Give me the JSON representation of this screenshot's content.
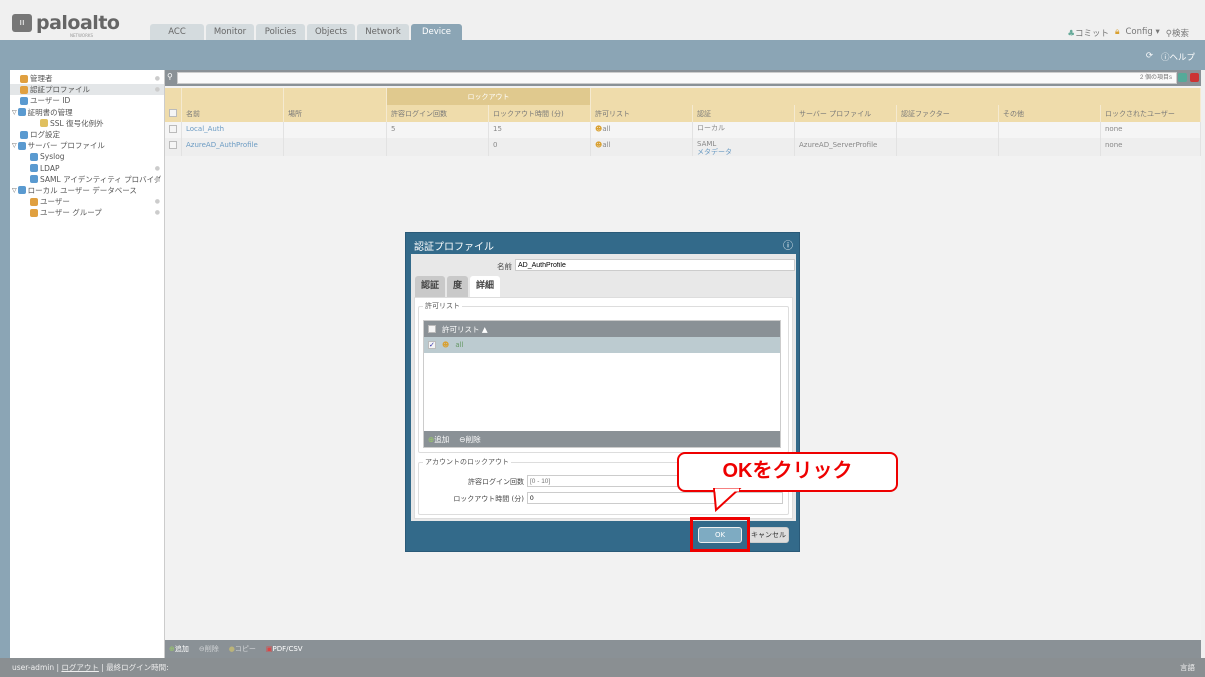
{
  "header": {
    "logo": "paloalto",
    "logo_sub": "NETWORKS",
    "tabs": [
      "ACC",
      "Monitor",
      "Policies",
      "Objects",
      "Network",
      "Device"
    ],
    "active_tab": "Device",
    "commit": "コミット",
    "config": "Config",
    "search": "検索",
    "help": "ヘルプ"
  },
  "sidebar": {
    "items": [
      {
        "label": "管理者",
        "indent": 0,
        "color": "#e0a040"
      },
      {
        "label": "認証プロファイル",
        "indent": 0,
        "color": "#e0a040",
        "selected": true
      },
      {
        "label": "ユーザー ID",
        "indent": 0,
        "color": "#5a9ad0"
      },
      {
        "label": "証明書の管理",
        "indent": 0,
        "color": "#5a9ad0",
        "expand": true
      },
      {
        "label": "SSL 復号化例外",
        "indent": 2,
        "color": "#e0c060"
      },
      {
        "label": "ログ設定",
        "indent": 0,
        "color": "#5a9ad0"
      },
      {
        "label": "サーバー プロファイル",
        "indent": 0,
        "color": "#5a9ad0",
        "expand": true
      },
      {
        "label": "Syslog",
        "indent": 1,
        "color": "#5a9ad0"
      },
      {
        "label": "LDAP",
        "indent": 1,
        "color": "#5a9ad0"
      },
      {
        "label": "SAML アイデンティティ プロバイダ",
        "indent": 1,
        "color": "#5a9ad0"
      },
      {
        "label": "ローカル ユーザー データベース",
        "indent": 0,
        "color": "#5a9ad0",
        "expand": true
      },
      {
        "label": "ユーザー",
        "indent": 1,
        "color": "#e0a040"
      },
      {
        "label": "ユーザー グループ",
        "indent": 1,
        "color": "#e0a040"
      }
    ]
  },
  "search": {
    "count": "2 個の項目s"
  },
  "table": {
    "group_header": "ロックアウト",
    "columns": [
      "名前",
      "場所",
      "許容ログイン回数",
      "ロックアウト時間 (分)",
      "許可リスト",
      "認証",
      "サーバー プロファイル",
      "認証ファクター",
      "その他",
      "ロックされたユーザー"
    ],
    "rows": [
      {
        "name": "Local_Auth",
        "location": "",
        "attempts": "5",
        "lockout": "15",
        "allow": "all",
        "auth": "ローカル",
        "auth2": "",
        "server": "",
        "factor": "",
        "other": "",
        "locked": "none"
      },
      {
        "name": "AzureAD_AuthProfile",
        "location": "",
        "attempts": "",
        "lockout": "0",
        "allow": "all",
        "auth": "SAML",
        "auth2": "メタデータ",
        "server": "AzureAD_ServerProfile",
        "factor": "",
        "other": "",
        "locked": "none"
      }
    ]
  },
  "toolbar": {
    "add": "追加",
    "delete": "削除",
    "copy": "コピー",
    "pdf": "PDF/CSV"
  },
  "footer": {
    "user": "user-admin",
    "logout": "ログアウト",
    "last_login": "最終ログイン時間:",
    "language": "言語"
  },
  "dialog": {
    "title": "認証プロファイル",
    "name_label": "名前",
    "name_value": "AD_AuthProfile",
    "tabs": [
      "認証",
      "度",
      "詳細"
    ],
    "active_tab": "詳細",
    "allow_legend": "許可リスト",
    "allow_header": "許可リスト ▲",
    "allow_item": "all",
    "add": "追加",
    "delete": "削除",
    "lockout_legend": "アカウントのロックアウト",
    "attempts_label": "許容ログイン回数",
    "attempts_placeholder": "[0 - 10]",
    "lockout_label": "ロックアウト時間 (分)",
    "lockout_value": "0",
    "ok": "OK",
    "cancel": "キャンセル"
  },
  "annotation": {
    "callout": "OKをクリック"
  }
}
